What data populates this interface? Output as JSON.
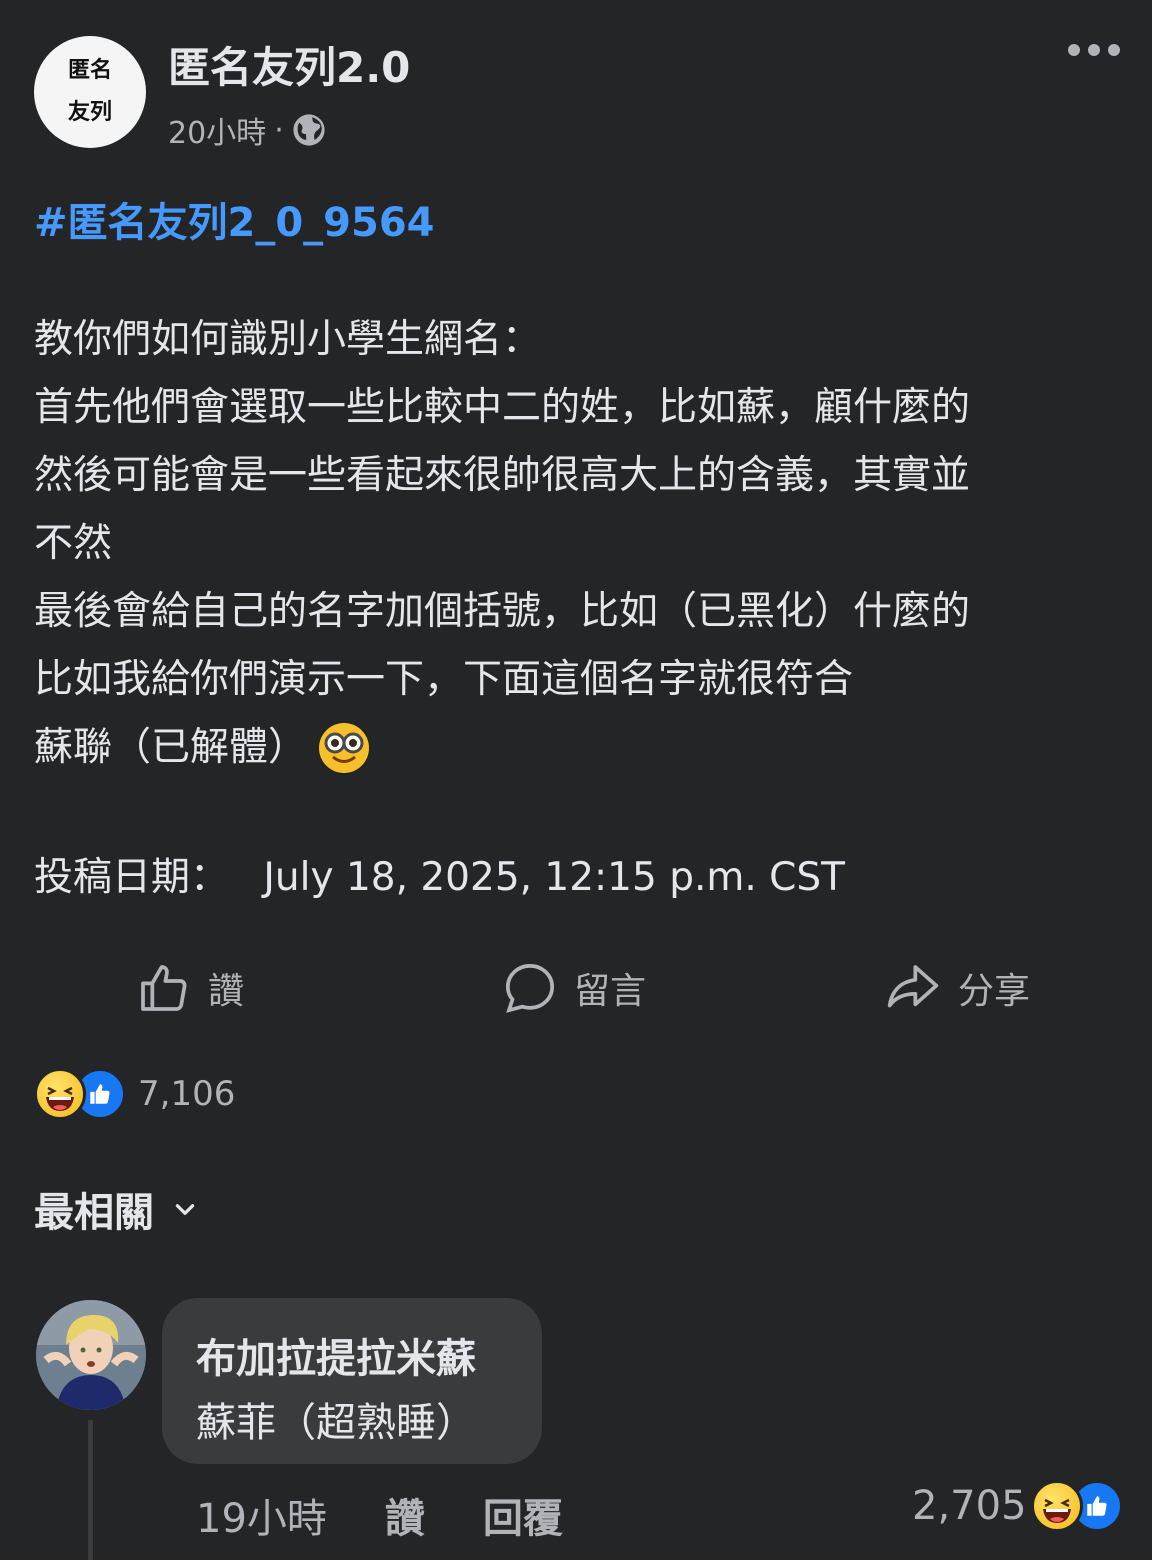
{
  "post": {
    "avatar_line1": "匿名",
    "avatar_line2": "友列",
    "page_name": "匿名友列2.0",
    "time": "20小時",
    "separator": "·",
    "hashtag": "#匿名友列2_0_9564",
    "lines": [
      "教你們如何識別小學生網名：",
      "首先他們會選取一些比較中二的姓，比如蘇，顧什麼的",
      "然後可能會是一些看起來很帥很高大上的含義，其實並",
      "不然",
      "最後會給自己的名字加個括號，比如（已黑化）什麼的",
      "比如我給你們演示一下，下面這個名字就很符合",
      "蘇聯（已解體）"
    ],
    "emoji_icon": "nerd-face-emoji",
    "date_label": "投稿日期：",
    "date_value": "July 18, 2025, 12:15 p.m. CST"
  },
  "actions": {
    "like": "讚",
    "comment": "留言",
    "share": "分享"
  },
  "reactions": {
    "icons": [
      "haha-emoji",
      "like-emoji"
    ],
    "count": "7,106"
  },
  "sort": {
    "label": "最相關"
  },
  "comment": {
    "author": "布加拉提拉米蘇",
    "text": "蘇菲（超熟睡）",
    "time": "19小時",
    "like_label": "讚",
    "reply_label": "回覆",
    "reaction_count": "2,705"
  },
  "colors": {
    "background": "#242526",
    "text": "#e4e6eb",
    "secondary": "#b0b3b8",
    "hashtag": "#4599ff",
    "like_blue": "#1877f2",
    "bubble": "#3a3b3c"
  }
}
